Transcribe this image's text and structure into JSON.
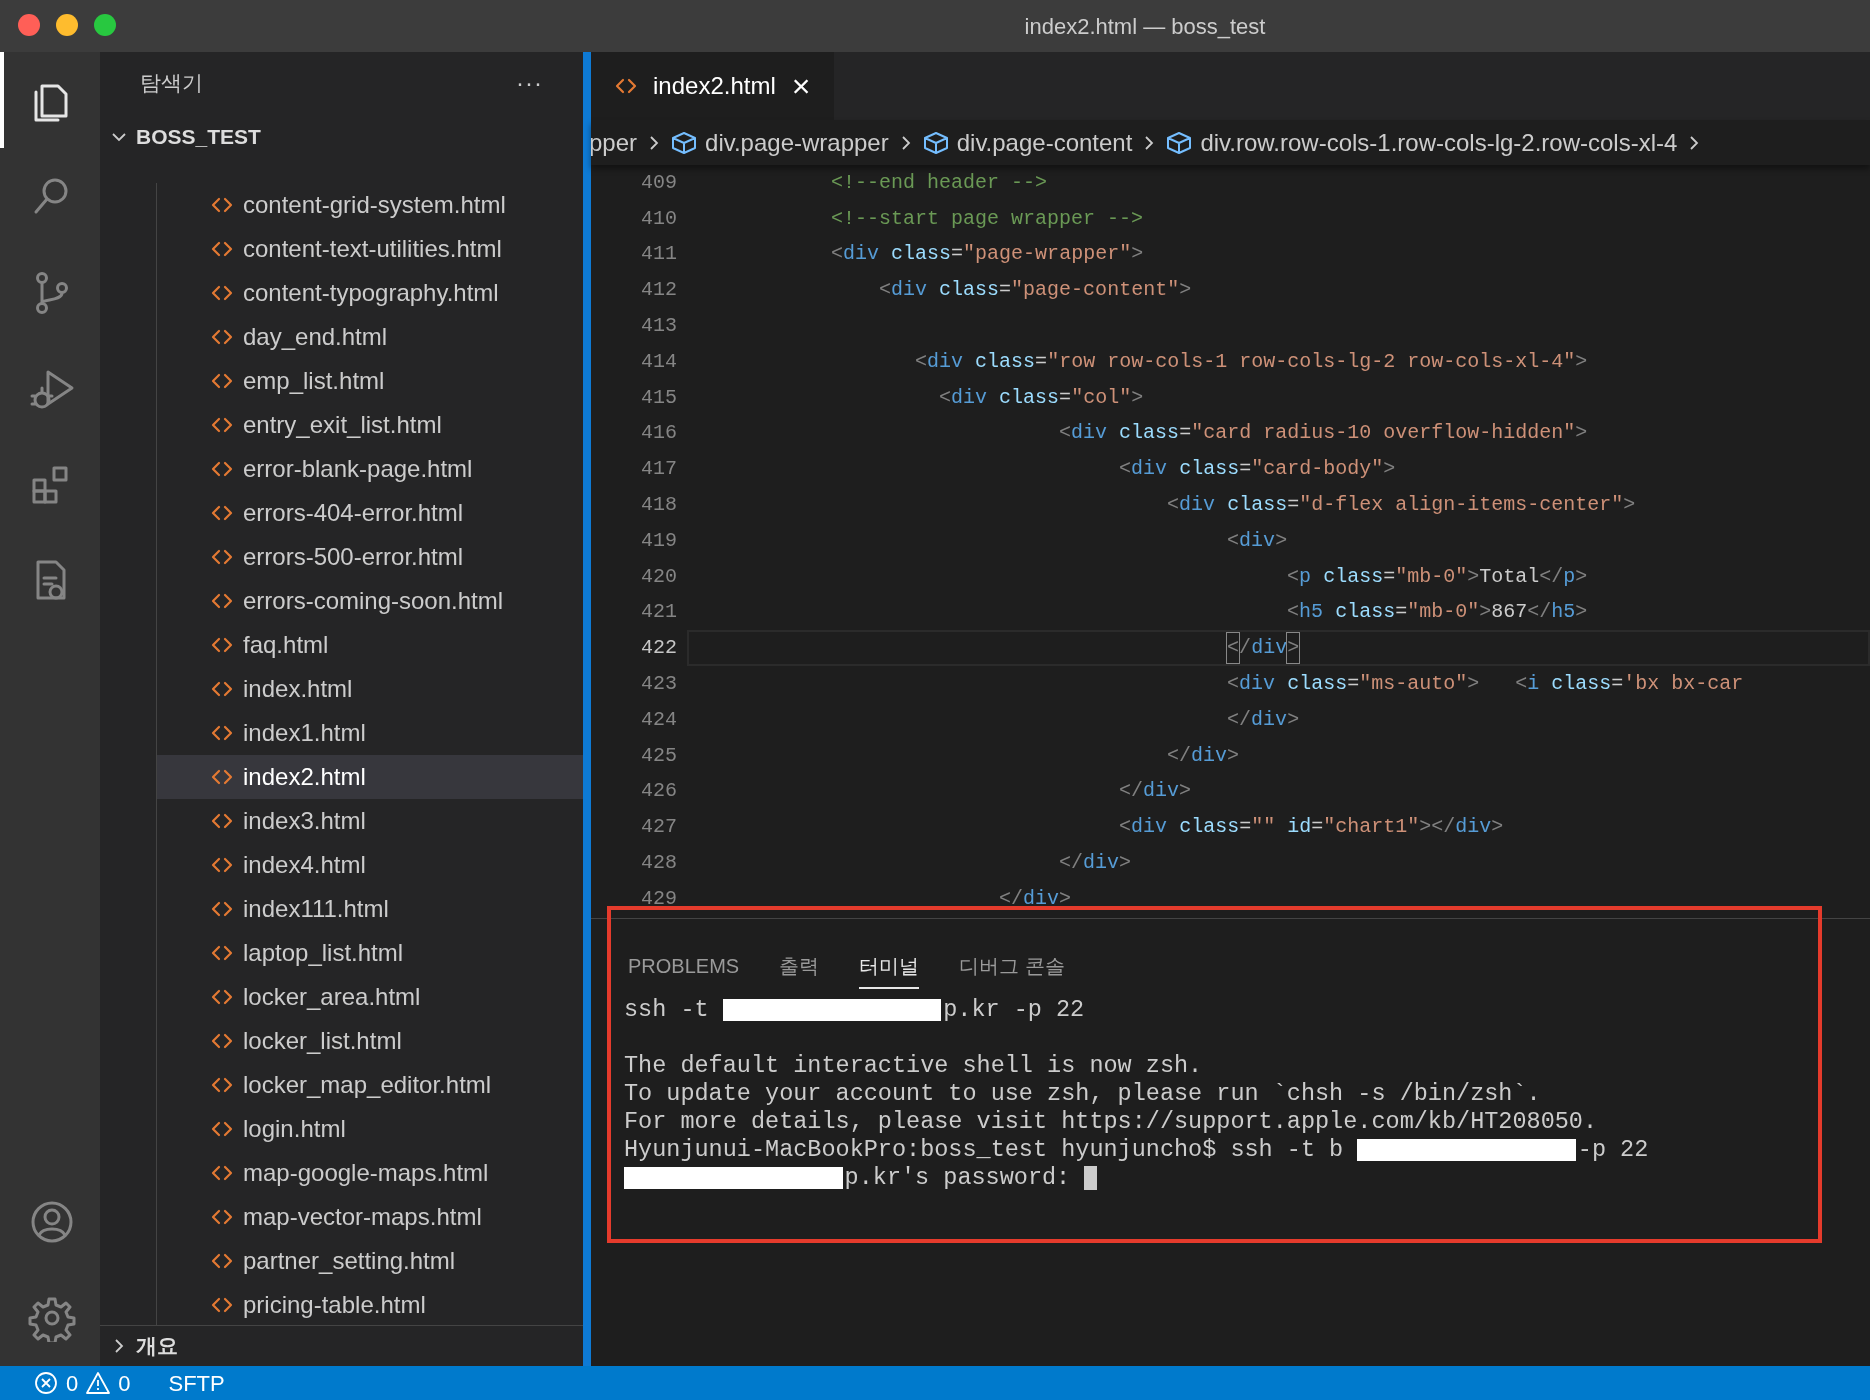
{
  "window": {
    "title": "index2.html — boss_test"
  },
  "activity_bar": [
    {
      "kind": "files",
      "selected": true
    },
    {
      "kind": "search",
      "selected": false
    },
    {
      "kind": "scm",
      "selected": false
    },
    {
      "kind": "run",
      "selected": false
    },
    {
      "kind": "extensions",
      "selected": false
    },
    {
      "kind": "document",
      "selected": false
    }
  ],
  "activity_bar_bottom": [
    {
      "kind": "account"
    },
    {
      "kind": "settings"
    }
  ],
  "sidebar": {
    "title": "탐색기",
    "more": "···",
    "folder": {
      "label": "BOSS_TEST",
      "expanded": true
    },
    "files": [
      {
        "label": "content-grid-system.html",
        "selected": false
      },
      {
        "label": "content-text-utilities.html",
        "selected": false
      },
      {
        "label": "content-typography.html",
        "selected": false
      },
      {
        "label": "day_end.html",
        "selected": false
      },
      {
        "label": "emp_list.html",
        "selected": false
      },
      {
        "label": "entry_exit_list.html",
        "selected": false
      },
      {
        "label": "error-blank-page.html",
        "selected": false
      },
      {
        "label": "errors-404-error.html",
        "selected": false
      },
      {
        "label": "errors-500-error.html",
        "selected": false
      },
      {
        "label": "errors-coming-soon.html",
        "selected": false
      },
      {
        "label": "faq.html",
        "selected": false
      },
      {
        "label": "index.html",
        "selected": false
      },
      {
        "label": "index1.html",
        "selected": false
      },
      {
        "label": "index2.html",
        "selected": true
      },
      {
        "label": "index3.html",
        "selected": false
      },
      {
        "label": "index4.html",
        "selected": false
      },
      {
        "label": "index111.html",
        "selected": false
      },
      {
        "label": "laptop_list.html",
        "selected": false
      },
      {
        "label": "locker_area.html",
        "selected": false
      },
      {
        "label": "locker_list.html",
        "selected": false
      },
      {
        "label": "locker_map_editor.html",
        "selected": false
      },
      {
        "label": "login.html",
        "selected": false
      },
      {
        "label": "map-google-maps.html",
        "selected": false
      },
      {
        "label": "map-vector-maps.html",
        "selected": false
      },
      {
        "label": "partner_setting.html",
        "selected": false
      },
      {
        "label": "pricing-table.html",
        "selected": false
      }
    ],
    "outline": {
      "label": "개요",
      "expanded": false
    }
  },
  "editor": {
    "tabs": [
      {
        "label": "index2.html",
        "selected": true,
        "close": "×"
      }
    ],
    "breadcrumbs": [
      {
        "label": "pper",
        "kind": "text"
      },
      {
        "label": "div.page-wrapper",
        "kind": "element"
      },
      {
        "label": "div.page-content",
        "kind": "element"
      },
      {
        "label": "div.row.row-cols-1.row-cols-lg-2.row-cols-xl-4",
        "kind": "element"
      }
    ],
    "lines": [
      {
        "number": "409",
        "current": false,
        "tokens": [
          {
            "kind": "comment",
            "text": "          <!--end header -->"
          }
        ]
      },
      {
        "number": "410",
        "current": false,
        "tokens": [
          {
            "kind": "comment",
            "text": "          <!--start page wrapper -->"
          }
        ]
      },
      {
        "number": "411",
        "current": false,
        "tokens": [
          {
            "kind": "punct",
            "text": "          <"
          },
          {
            "kind": "tag",
            "text": "div"
          },
          {
            "kind": "attr",
            "text": " class"
          },
          {
            "kind": "plain",
            "text": "="
          },
          {
            "kind": "string",
            "text": "\"page-wrapper\""
          },
          {
            "kind": "punct",
            "text": ">"
          }
        ]
      },
      {
        "number": "412",
        "current": false,
        "tokens": [
          {
            "kind": "punct",
            "text": "              <"
          },
          {
            "kind": "tag",
            "text": "div"
          },
          {
            "kind": "attr",
            "text": " class"
          },
          {
            "kind": "plain",
            "text": "="
          },
          {
            "kind": "string",
            "text": "\"page-content\""
          },
          {
            "kind": "punct",
            "text": ">"
          }
        ]
      },
      {
        "number": "413",
        "current": false
      },
      {
        "number": "414",
        "current": false,
        "tokens": [
          {
            "kind": "punct",
            "text": "                 <"
          },
          {
            "kind": "tag",
            "text": "div"
          },
          {
            "kind": "attr",
            "text": " class"
          },
          {
            "kind": "plain",
            "text": "="
          },
          {
            "kind": "string",
            "text": "\"row row-cols-1 row-cols-lg-2 row-cols-xl-4\""
          },
          {
            "kind": "punct",
            "text": ">"
          }
        ]
      },
      {
        "number": "415",
        "current": false,
        "tokens": [
          {
            "kind": "punct",
            "text": "                   <"
          },
          {
            "kind": "tag",
            "text": "div"
          },
          {
            "kind": "attr",
            "text": " class"
          },
          {
            "kind": "plain",
            "text": "="
          },
          {
            "kind": "string",
            "text": "\"col\""
          },
          {
            "kind": "punct",
            "text": ">"
          }
        ]
      },
      {
        "number": "416",
        "current": false,
        "tokens": [
          {
            "kind": "punct",
            "text": "                             <"
          },
          {
            "kind": "tag",
            "text": "div"
          },
          {
            "kind": "attr",
            "text": " class"
          },
          {
            "kind": "plain",
            "text": "="
          },
          {
            "kind": "string",
            "text": "\"card radius-10 overflow-hidden\""
          },
          {
            "kind": "punct",
            "text": ">"
          }
        ]
      },
      {
        "number": "417",
        "current": false,
        "tokens": [
          {
            "kind": "punct",
            "text": "                                  <"
          },
          {
            "kind": "tag",
            "text": "div"
          },
          {
            "kind": "attr",
            "text": " class"
          },
          {
            "kind": "plain",
            "text": "="
          },
          {
            "kind": "string",
            "text": "\"card-body\""
          },
          {
            "kind": "punct",
            "text": ">"
          }
        ]
      },
      {
        "number": "418",
        "current": false,
        "tokens": [
          {
            "kind": "punct",
            "text": "                                      <"
          },
          {
            "kind": "tag",
            "text": "div"
          },
          {
            "kind": "attr",
            "text": " class"
          },
          {
            "kind": "plain",
            "text": "="
          },
          {
            "kind": "string",
            "text": "\"d-flex align-items-center\""
          },
          {
            "kind": "punct",
            "text": ">"
          }
        ]
      },
      {
        "number": "419",
        "current": false,
        "tokens": [
          {
            "kind": "punct",
            "text": "                                           <"
          },
          {
            "kind": "tag",
            "text": "div"
          },
          {
            "kind": "punct",
            "text": ">"
          }
        ]
      },
      {
        "number": "420",
        "current": false,
        "tokens": [
          {
            "kind": "punct",
            "text": "                                                <"
          },
          {
            "kind": "tag",
            "text": "p"
          },
          {
            "kind": "attr",
            "text": " class"
          },
          {
            "kind": "plain",
            "text": "="
          },
          {
            "kind": "string",
            "text": "\"mb-0\""
          },
          {
            "kind": "punct",
            "text": ">"
          },
          {
            "kind": "plain",
            "text": "Total"
          },
          {
            "kind": "punct",
            "text": "</"
          },
          {
            "kind": "tag",
            "text": "p"
          },
          {
            "kind": "punct",
            "text": ">"
          }
        ]
      },
      {
        "number": "421",
        "current": false,
        "tokens": [
          {
            "kind": "punct",
            "text": "                                                <"
          },
          {
            "kind": "tag",
            "text": "h5"
          },
          {
            "kind": "attr",
            "text": " class"
          },
          {
            "kind": "plain",
            "text": "="
          },
          {
            "kind": "string",
            "text": "\"mb-0\""
          },
          {
            "kind": "punct",
            "text": ">"
          },
          {
            "kind": "plain",
            "text": "867"
          },
          {
            "kind": "punct",
            "text": "</"
          },
          {
            "kind": "tag",
            "text": "h5"
          },
          {
            "kind": "punct",
            "text": ">"
          }
        ]
      },
      {
        "number": "422",
        "current": true,
        "tokens": [
          {
            "kind": "match",
            "text": "                                           <"
          },
          {
            "kind": "punct",
            "text": "/"
          },
          {
            "kind": "tag",
            "text": "div"
          },
          {
            "kind": "match",
            "text": ">"
          }
        ]
      },
      {
        "number": "423",
        "current": false,
        "tokens": [
          {
            "kind": "punct",
            "text": "                                           <"
          },
          {
            "kind": "tag",
            "text": "div"
          },
          {
            "kind": "attr",
            "text": " class"
          },
          {
            "kind": "plain",
            "text": "="
          },
          {
            "kind": "string",
            "text": "\"ms-auto\""
          },
          {
            "kind": "punct",
            "text": ">"
          },
          {
            "kind": "punct",
            "text": "   <"
          },
          {
            "kind": "tag",
            "text": "i"
          },
          {
            "kind": "attr",
            "text": " class"
          },
          {
            "kind": "plain",
            "text": "="
          },
          {
            "kind": "string",
            "text": "'bx bx-car"
          }
        ]
      },
      {
        "number": "424",
        "current": false,
        "tokens": [
          {
            "kind": "punct",
            "text": "                                           </"
          },
          {
            "kind": "tag",
            "text": "div"
          },
          {
            "kind": "punct",
            "text": ">"
          }
        ]
      },
      {
        "number": "425",
        "current": false,
        "tokens": [
          {
            "kind": "punct",
            "text": "                                      </"
          },
          {
            "kind": "tag",
            "text": "div"
          },
          {
            "kind": "punct",
            "text": ">"
          }
        ]
      },
      {
        "number": "426",
        "current": false,
        "tokens": [
          {
            "kind": "punct",
            "text": "                                  </"
          },
          {
            "kind": "tag",
            "text": "div"
          },
          {
            "kind": "punct",
            "text": ">"
          }
        ]
      },
      {
        "number": "427",
        "current": false,
        "tokens": [
          {
            "kind": "punct",
            "text": "                                  <"
          },
          {
            "kind": "tag",
            "text": "div"
          },
          {
            "kind": "attr",
            "text": " class"
          },
          {
            "kind": "plain",
            "text": "="
          },
          {
            "kind": "string",
            "text": "\"\""
          },
          {
            "kind": "attr",
            "text": " id"
          },
          {
            "kind": "plain",
            "text": "="
          },
          {
            "kind": "string",
            "text": "\"chart1\""
          },
          {
            "kind": "punct",
            "text": "></"
          },
          {
            "kind": "tag",
            "text": "div"
          },
          {
            "kind": "punct",
            "text": ">"
          }
        ]
      },
      {
        "number": "428",
        "current": false,
        "tokens": [
          {
            "kind": "punct",
            "text": "                             </"
          },
          {
            "kind": "tag",
            "text": "div"
          },
          {
            "kind": "punct",
            "text": ">"
          }
        ]
      },
      {
        "number": "429",
        "current": false,
        "tokens": [
          {
            "kind": "punct",
            "text": "                        </"
          },
          {
            "kind": "tag",
            "text": "div"
          },
          {
            "kind": "punct",
            "text": ">"
          }
        ]
      }
    ]
  },
  "panel": {
    "tabs": [
      {
        "label": "PROBLEMS",
        "selected": false
      },
      {
        "label": "출력",
        "selected": false
      },
      {
        "label": "터미널",
        "selected": true
      },
      {
        "label": "디버그 콘솔",
        "selected": false
      }
    ],
    "terminal": [
      {
        "lines": [
          {
            "segments": [
              {
                "kind": "text",
                "text": "ssh -t"
              },
              {
                "kind": "redacted"
              },
              {
                "kind": "text",
                "text": "p.kr -p 22"
              }
            ]
          }
        ]
      },
      {
        "lines": [
          {
            "segments": [
              {
                "kind": "text",
                "text": "The default interactive shell is now zsh."
              }
            ]
          },
          {
            "segments": [
              {
                "kind": "text",
                "text": "To update your account to use zsh, please run `chsh -s /bin/zsh`."
              }
            ]
          },
          {
            "segments": [
              {
                "kind": "text",
                "text": "For more details, please visit https://support.apple.com/kb/HT208050."
              }
            ]
          },
          {
            "segments": [
              {
                "kind": "text",
                "text": "Hyunjunui-MacBookPro:boss_test hyunjuncho$ ssh -t b"
              },
              {
                "kind": "redacted"
              },
              {
                "kind": "text",
                "text": "-p 22"
              }
            ]
          },
          {
            "segments": [
              {
                "kind": "redacted"
              },
              {
                "kind": "text",
                "text": "p.kr's password:"
              },
              {
                "kind": "cursor"
              }
            ]
          }
        ]
      }
    ]
  },
  "status_bar": {
    "errors": "0",
    "warnings": "0",
    "items": [
      "SFTP"
    ]
  }
}
